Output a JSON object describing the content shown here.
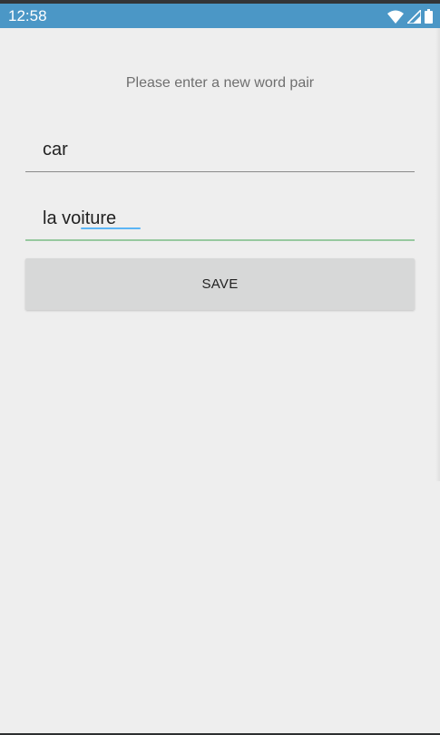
{
  "status_bar": {
    "time": "12:58",
    "icons": [
      "wifi-icon",
      "cell-signal-icon",
      "battery-icon"
    ],
    "color": "#4b97c6"
  },
  "form": {
    "prompt": "Please enter a new word pair",
    "word_value": "car",
    "translation_value": "la voiture",
    "save_label": "SAVE"
  },
  "colors": {
    "background": "#eeeeee",
    "accent_underline": "#97c99f",
    "spellcheck_underline": "#5bb5f5",
    "button_bg": "#d7d8d8"
  }
}
